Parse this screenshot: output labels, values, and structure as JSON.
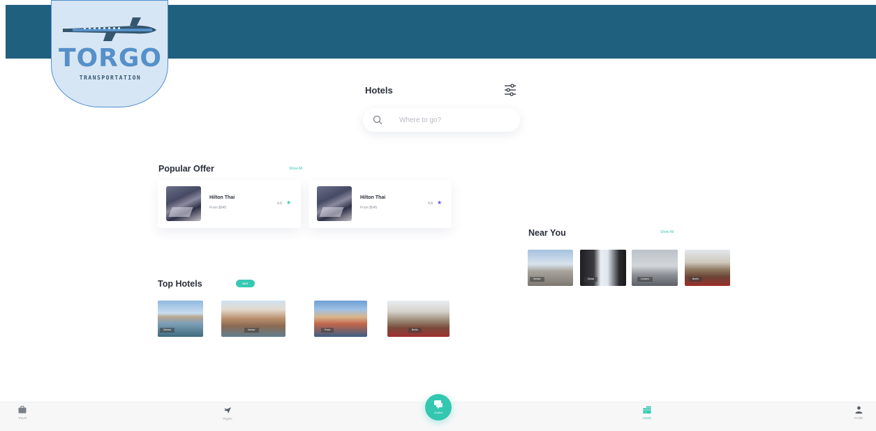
{
  "brand": {
    "name": "TORGO",
    "tagline": "TRANSPORTATION"
  },
  "header": {
    "title": "Hotels",
    "filter_icon": "sliders-icon"
  },
  "search": {
    "placeholder": "Where to go?",
    "value": ""
  },
  "popular_offer": {
    "title": "Popular Offer",
    "show_all": "Show All",
    "cards": [
      {
        "name": "Hilton Thai",
        "price": "From $645",
        "rating": "4.8",
        "star_color": "#38c9b3"
      },
      {
        "name": "Hilton Thai",
        "price": "From $645",
        "rating": "4.8",
        "star_color": "#6b4fe0"
      }
    ]
  },
  "top_hotels": {
    "title": "Top Hotels",
    "badge": "HOT",
    "items": [
      {
        "label": "Vienna"
      },
      {
        "label": "Venice"
      },
      {
        "label": "Porto"
      },
      {
        "label": "Berlin"
      }
    ]
  },
  "near_you": {
    "title": "Near You",
    "show_all": "Show All",
    "items": [
      {
        "label": "Venice"
      },
      {
        "label": "Dubai"
      },
      {
        "label": "London"
      },
      {
        "label": "Berlin"
      }
    ]
  },
  "bottom_nav": {
    "items": [
      {
        "label": "Travel",
        "icon": "briefcase-icon"
      },
      {
        "label": "Flights",
        "icon": "airplane-icon"
      },
      {
        "label": "Chatbot",
        "icon": "chat-icon"
      },
      {
        "label": "Hotels",
        "icon": "building-icon",
        "active": true
      },
      {
        "label": "Profile",
        "icon": "user-icon"
      }
    ]
  },
  "colors": {
    "header": "#20607f",
    "accent": "#38c9b3",
    "logo_text": "#5590c9"
  }
}
